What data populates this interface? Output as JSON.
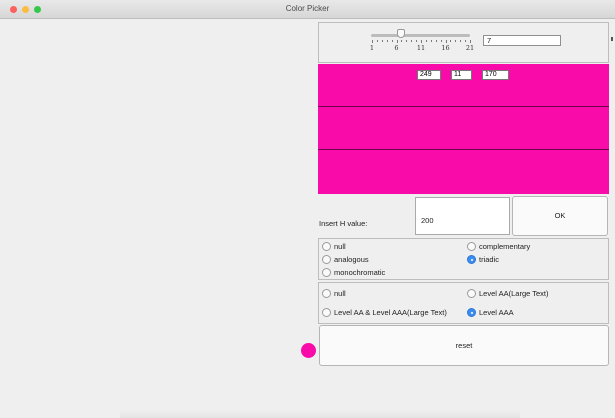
{
  "window": {
    "title": "Color Picker"
  },
  "colors": {
    "swatch": "#f90baa",
    "accent": "#3b8df2"
  },
  "slider": {
    "value": 7,
    "min": 1,
    "max": 21,
    "tick_labels": [
      "1",
      "6",
      "11",
      "16",
      "21"
    ],
    "value_text": "7"
  },
  "rgb": {
    "r": "249",
    "g": "11",
    "b": "170"
  },
  "h_input": {
    "label": "Insert H value:",
    "value": "200"
  },
  "buttons": {
    "ok": "OK",
    "reset": "reset"
  },
  "scheme_options": {
    "null": "null",
    "complementary": "complementary",
    "analogous": "analogous",
    "triadic": "triadic",
    "monochromatic": "monochromatic",
    "selected": "triadic"
  },
  "contrast_options": {
    "null": "null",
    "level_aa_large": "Level AA(Large Text)",
    "level_aa_aaa_large": "Level AA & Level AAA(Large Text)",
    "level_aaa": "Level AAA",
    "selected": "Level AAA"
  }
}
